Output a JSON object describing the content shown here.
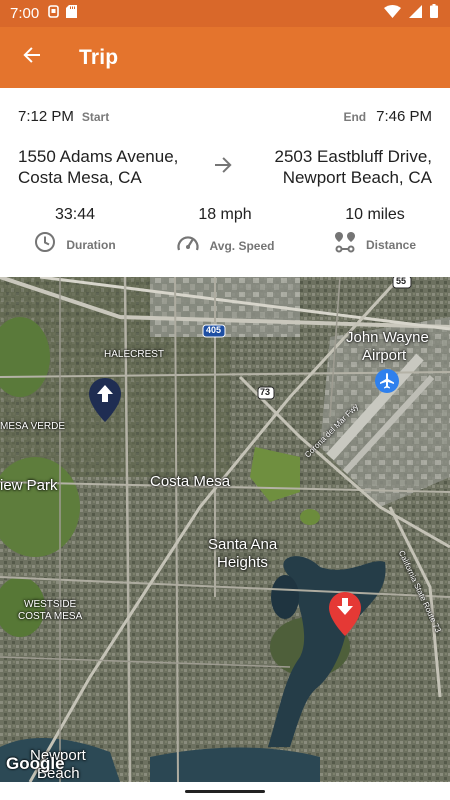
{
  "status_bar": {
    "time": "7:00",
    "left_icons": [
      "sync-icon",
      "sd-card-icon"
    ],
    "right_icons": [
      "wifi-icon",
      "signal-icon",
      "battery-icon"
    ]
  },
  "app_bar": {
    "title": "Trip",
    "back_icon": "arrow-back-icon"
  },
  "trip": {
    "start_time": "7:12 PM",
    "start_label": "Start",
    "end_time": "7:46 PM",
    "end_label": "End",
    "start_address_line1": "1550 Adams Avenue,",
    "start_address_line2": "Costa Mesa, CA",
    "end_address_line1": "2503 Eastbluff Drive,",
    "end_address_line2": "Newport Beach, CA",
    "stats": [
      {
        "value": "33:44",
        "label": "Duration",
        "icon": "clock-icon"
      },
      {
        "value": "18 mph",
        "label": "Avg. Speed",
        "icon": "speedometer-icon"
      },
      {
        "value": "10 miles",
        "label": "Distance",
        "icon": "route-icon"
      }
    ]
  },
  "map": {
    "labels": {
      "halecrest": "HALECREST",
      "mesa_verde": "MESA VERDE",
      "view_park": "iew Park",
      "costa_mesa": "Costa Mesa",
      "santa_ana_1": "Santa Ana",
      "santa_ana_2": "Heights",
      "westside_1": "WESTSIDE",
      "westside_2": "COSTA MESA",
      "newport_1": "Newport",
      "newport_2": "Beach",
      "john_wayne_1": "John Wayne",
      "john_wayne_2": "Airport",
      "freeway_405": "405",
      "freeway_73": "73",
      "freeway_55": "55",
      "corona_fwy": "Corona del Mar Fwy",
      "california_route": "California State Route 73"
    },
    "attribution": "Google",
    "start_marker_icon": "start-pin-icon",
    "end_marker_icon": "end-pin-icon",
    "airport_icon": "airplane-icon",
    "colors": {
      "start_marker": "#1f2d52",
      "end_marker": "#e53935",
      "airport": "#2f80ed"
    }
  },
  "theme": {
    "status_bar": "#d9682a",
    "app_bar": "#e4742d"
  }
}
